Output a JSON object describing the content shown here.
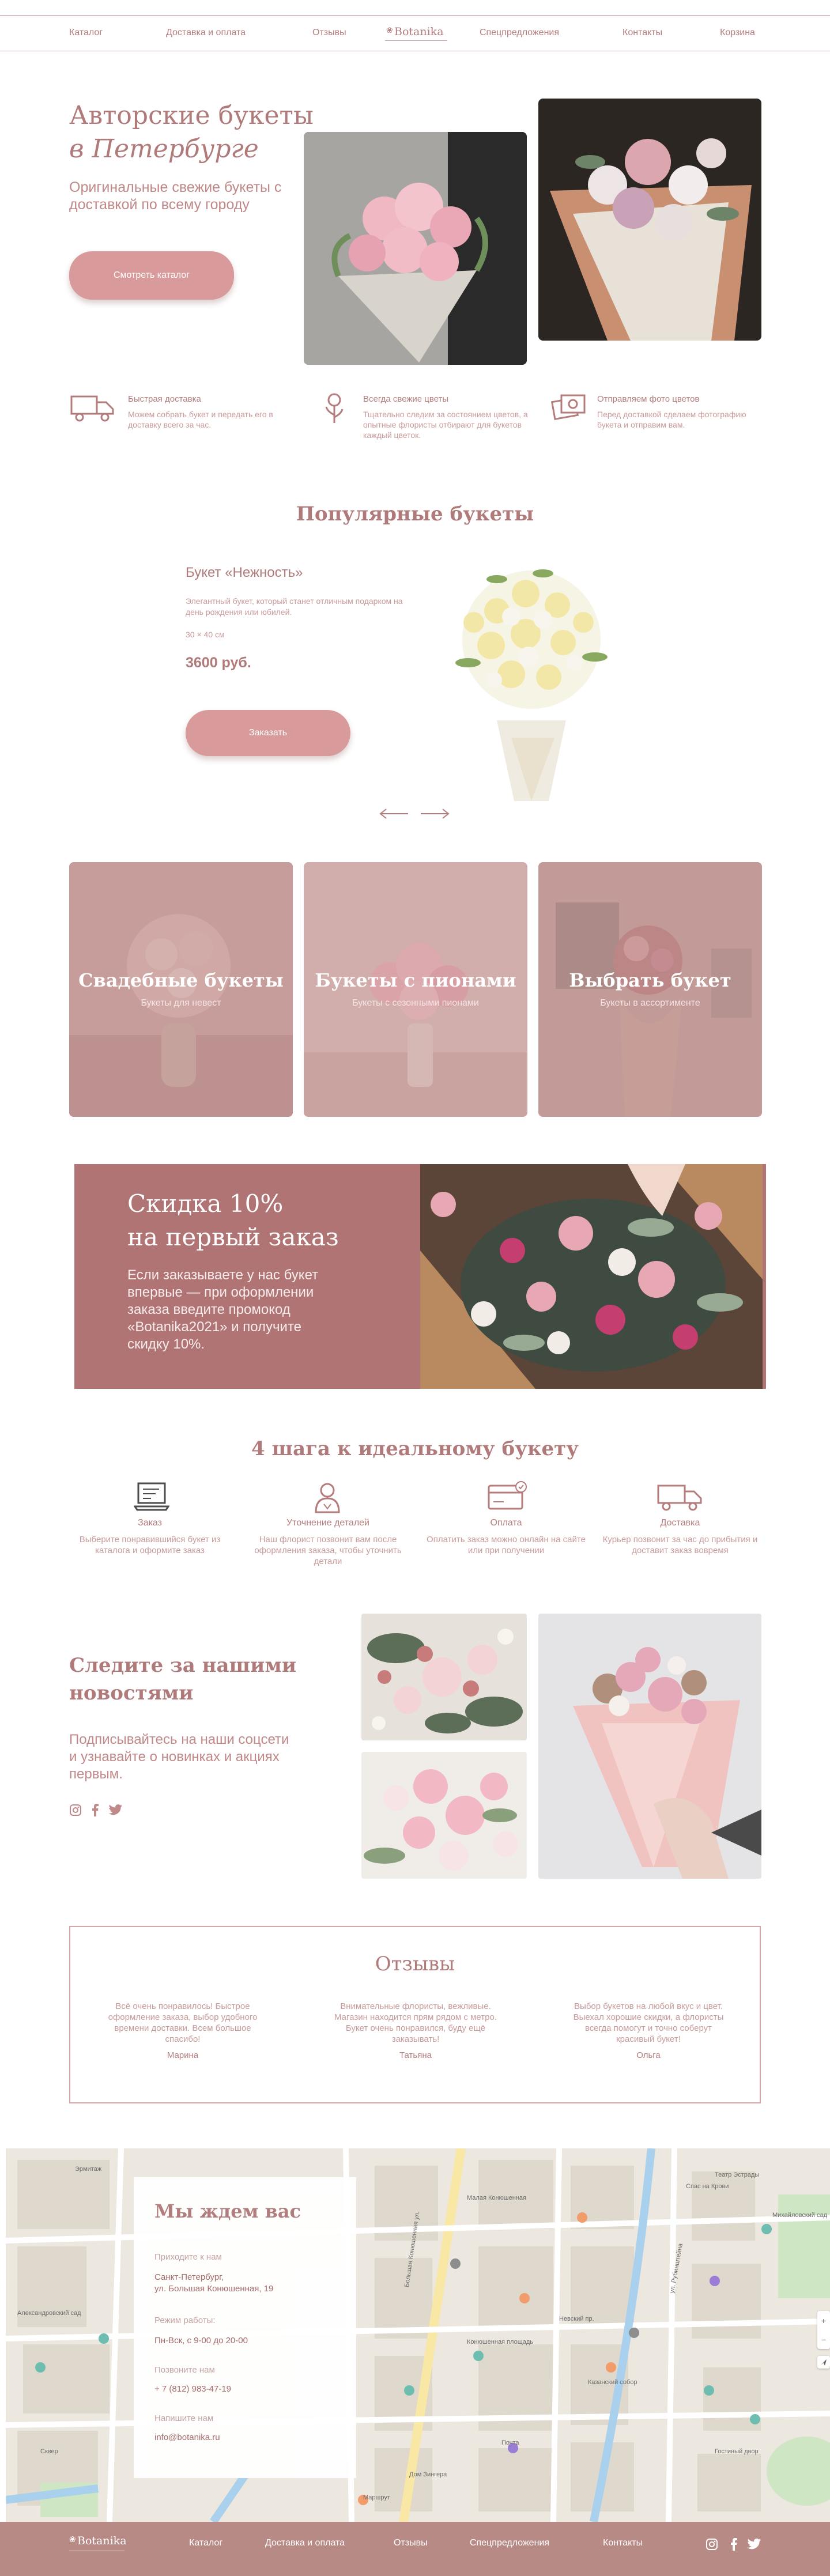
{
  "header": {
    "nav": [
      "Каталог",
      "Доставка и оплата",
      "Отзывы",
      "Спецпредложения",
      "Контакты",
      "Корзина"
    ],
    "logo": "Botanika"
  },
  "hero": {
    "title_line1": "Авторские букеты",
    "title_line2": "в Петербурге",
    "subtitle": "Оригинальные свежие букеты с доставкой по всему городу",
    "cta": "Смотреть каталог"
  },
  "features": [
    {
      "title": "Быстрая доставка",
      "text": "Можем собрать букет и передать его в доставку всего за час.",
      "icon": "truck-icon"
    },
    {
      "title": "Всегда свежие цветы",
      "text": "Тщательно следим за состоянием цветов, а опытные флористы отбирают для букетов каждый цветок.",
      "icon": "flower-icon"
    },
    {
      "title": "Отправляем фото цветов",
      "text": "Перед доставкой сделаем фотографию букета и отправим вам.",
      "icon": "photo-icon"
    }
  ],
  "popular": {
    "title": "Популярные букеты",
    "name": "Букет «Нежность»",
    "desc": "Элегантный букет, который станет отличным подарком на день рождения или юбилей.",
    "size": "30 × 40 см",
    "price": "3600 руб.",
    "order": "Заказать",
    "prev_icon": "arrow-left-icon",
    "next_icon": "arrow-right-icon"
  },
  "categories": [
    {
      "title": "Свадебные букеты",
      "sub": "Букеты для невест"
    },
    {
      "title": "Букеты с пионами",
      "sub": "Букеты с сезонными пионами"
    },
    {
      "title": "Выбрать букет",
      "sub": "Букеты в ассортименте"
    }
  ],
  "promo": {
    "title_line1": "Скидка 10%",
    "title_line2": "на первый заказ",
    "text": "Если заказываете у нас букет впервые — при оформлении заказа введите промокод «Botanika2021» и получите скидку 10%."
  },
  "steps": {
    "title": "4 шага к идеальному букету",
    "items": [
      {
        "title": "Заказ",
        "text": "Выберите понравившийся букет из каталога и оформите заказ",
        "icon": "laptop-icon"
      },
      {
        "title": "Уточнение деталей",
        "text": "Наш флорист позвонит вам после оформления заказа, чтобы уточнить детали",
        "icon": "florist-icon"
      },
      {
        "title": "Оплата",
        "text": "Оплатить заказ можно онлайн на сайте или при получении",
        "icon": "card-icon"
      },
      {
        "title": "Доставка",
        "text": "Курьер позвонит за час до прибытия и доставит заказ вовремя",
        "icon": "delivery-truck-icon"
      }
    ]
  },
  "social": {
    "title_line1": "Следите за нашими",
    "title_line2": "новостями",
    "text": "Подписывайтесь на наши соцсети и узнавайте о новинках и акциях первым."
  },
  "reviews": {
    "title": "Отзывы",
    "items": [
      {
        "text": "Всё очень понравилось! Быстрое оформление заказа, выбор удобного времени доставки. Всем большое спасибо!",
        "name": "Марина"
      },
      {
        "text": "Внимательные флористы, вежливые. Магазин находится прям рядом с метро. Букет очень понравился, буду ещё заказывать!",
        "name": "Татьяна"
      },
      {
        "text": "Выбор букетов на любой вкус и цвет. Выехал хорошие скидки, а флористы всегда помогут и точно соберут красивый букет!",
        "name": "Ольга"
      }
    ]
  },
  "contacts": {
    "title": "Мы ждем вас",
    "visit_label": "Приходите к нам",
    "address_line1": "Санкт-Петербург,",
    "address_line2": "ул. Большая Конюшенная, 19",
    "hours_label": "Режим работы:",
    "hours": "Пн-Вск, с 9-00 до 20-00",
    "call_label": "Позвоните нам",
    "phone": "+ 7 (812) 983-47-19",
    "write_label": "Напишите нам",
    "email": "info@botanika.ru"
  },
  "map": {
    "labels": [
      "Малая Конюшенная",
      "Большая Конюшенная ул.",
      "Невский пр.",
      "Казанский собор",
      "Дом Зингера",
      "Александровский сад",
      "Эрмитаж",
      "Театр Эстрады",
      "Михайловский сад",
      "Спас на Крови",
      "Конюшенная площадь",
      "Гостиный двор",
      "ул. Рубинштейна",
      "Сквер",
      "Маршрут",
      "Почта"
    ],
    "zoom_in": "+",
    "zoom_out": "−"
  },
  "footer": {
    "logo": "Botanika",
    "nav": [
      "Каталог",
      "Доставка и оплата",
      "Отзывы",
      "Спецпредложения",
      "Контакты"
    ]
  },
  "colors": {
    "accent": "#b47c7c",
    "button": "#d89a9a",
    "promo_bg": "#b07474",
    "footer_bg": "#b88a86"
  }
}
